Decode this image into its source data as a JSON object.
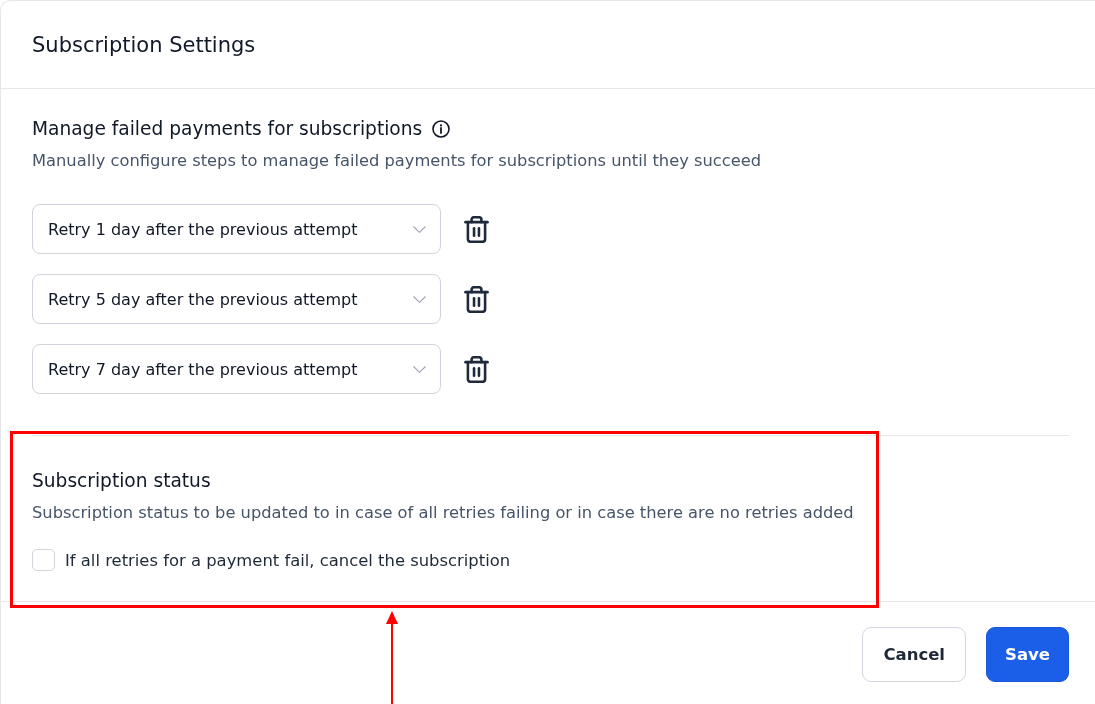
{
  "dialog": {
    "title": "Subscription Settings"
  },
  "failed_payments": {
    "title": "Manage failed payments for subscriptions",
    "description": "Manually configure steps to manage failed payments for subscriptions until they succeed",
    "retry_steps": [
      "Retry 1 day after the previous attempt",
      "Retry 5 day after the previous attempt",
      "Retry 7 day after the previous attempt"
    ]
  },
  "subscription_status": {
    "title": "Subscription status",
    "description": "Subscription status to be updated to in case of all retries failing or in case there are no retries added",
    "checkbox": {
      "label": "If all retries for a payment fail, cancel the subscription",
      "checked": false
    }
  },
  "buttons": [
    {
      "label": "Cancel",
      "kind": "secondary"
    },
    {
      "label": "Save",
      "kind": "primary"
    }
  ]
}
